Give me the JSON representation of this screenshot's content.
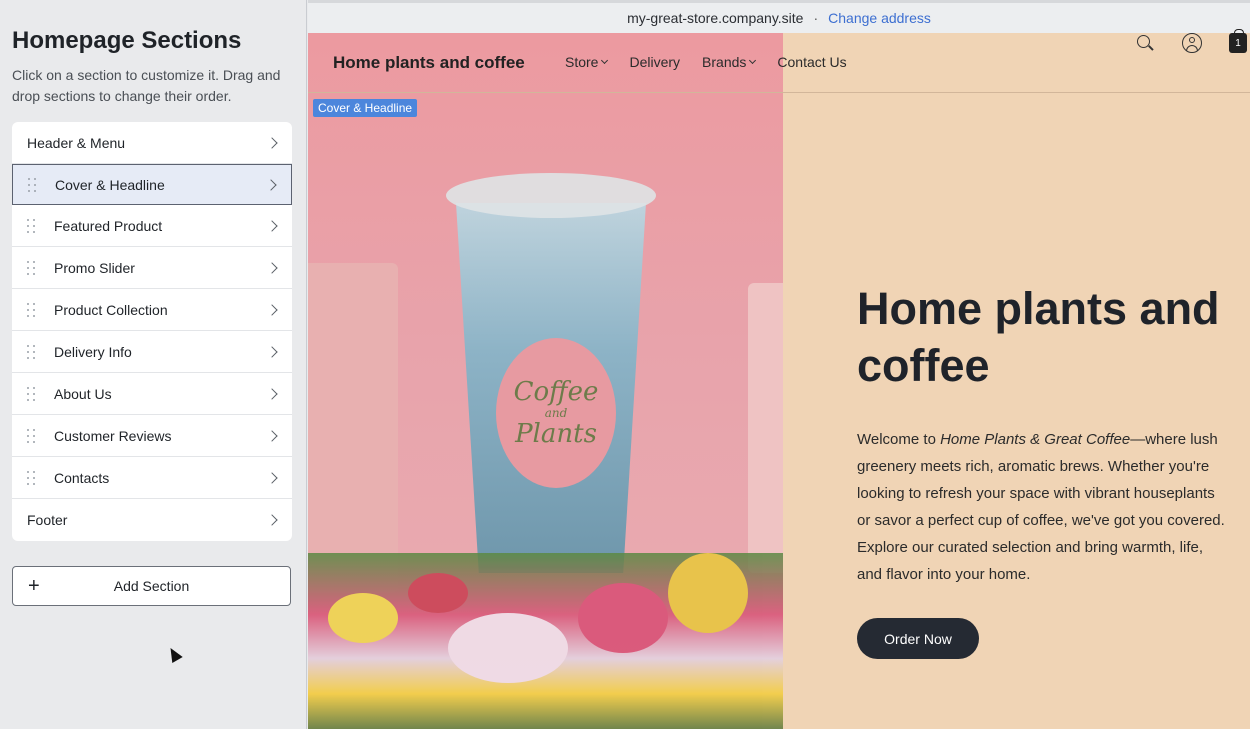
{
  "sidebar": {
    "title": "Homepage Sections",
    "description": "Click on a section to customize it. Drag and drop sections to change their order.",
    "sections": [
      {
        "label": "Header & Menu"
      },
      {
        "label": "Cover & Headline"
      },
      {
        "label": "Featured Product"
      },
      {
        "label": "Promo Slider"
      },
      {
        "label": "Product Collection"
      },
      {
        "label": "Delivery Info"
      },
      {
        "label": "About Us"
      },
      {
        "label": "Customer Reviews"
      },
      {
        "label": "Contacts"
      },
      {
        "label": "Footer"
      }
    ],
    "add_section_label": "Add Section"
  },
  "address_bar": {
    "url": "my-great-store.company.site",
    "separator": "·",
    "change_label": "Change address"
  },
  "store": {
    "brand": "Home plants and coffee",
    "nav": [
      {
        "label": "Store"
      },
      {
        "label": "Delivery"
      },
      {
        "label": "Brands"
      },
      {
        "label": "Contact Us"
      }
    ],
    "cart_count": "1"
  },
  "hero": {
    "section_tag": "Cover & Headline",
    "cup_text_top": "Coffee",
    "cup_text_mid": "and",
    "cup_text_bottom": "Plants",
    "title": "Home plants and coffee",
    "body_prefix": "Welcome to ",
    "body_em": "Home Plants & Great Coffee",
    "body_suffix": "—where lush greenery meets rich, aromatic brews. Whether you're looking to refresh your space with vibrant houseplants or savor a perfect cup of coffee, we've got you covered. Explore our curated selection and bring warmth, life, and flavor into your home.",
    "cta_label": "Order Now"
  },
  "colors": {
    "hero_bg": "#f0d4b5",
    "button_dark": "#252a33",
    "link_blue": "#3d6fd1",
    "tag_blue": "#4c86dc",
    "selected_bg": "#e6ebf6"
  },
  "icons": [
    "drag-handle-icon",
    "chevron-right-icon",
    "plus-icon",
    "search-icon",
    "account-icon",
    "cart-icon",
    "caret-down-icon",
    "mouse-cursor-icon"
  ]
}
